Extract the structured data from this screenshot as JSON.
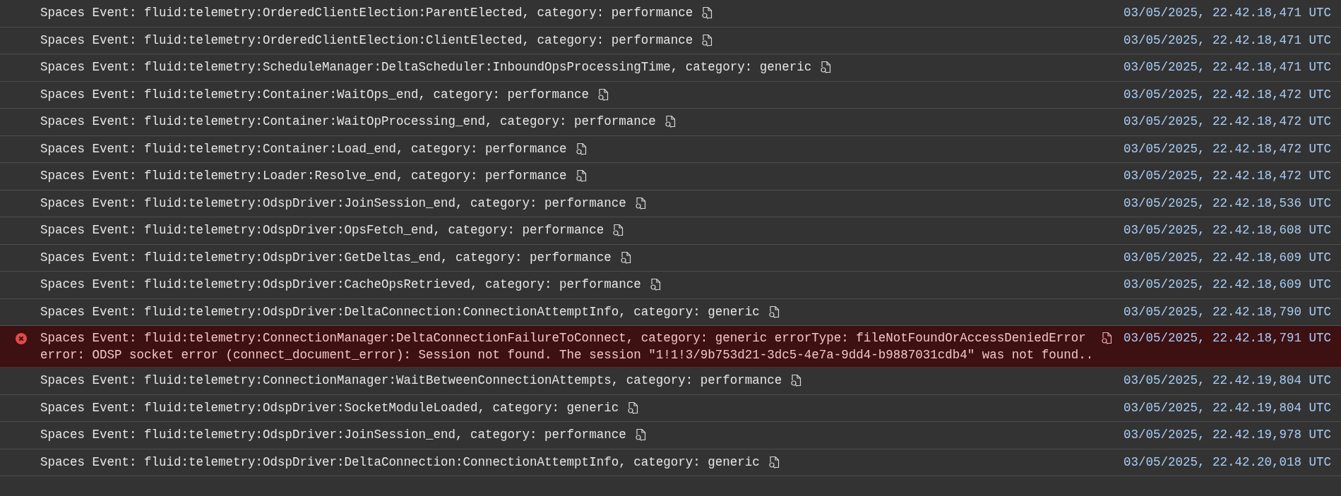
{
  "log_rows": [
    {
      "kind": "info",
      "message": "Spaces Event: fluid:telemetry:OrderedClientElection:ParentElected, category: performance",
      "timestamp": "03/05/2025, 22.42.18,471 UTC"
    },
    {
      "kind": "info",
      "message": "Spaces Event: fluid:telemetry:OrderedClientElection:ClientElected, category: performance",
      "timestamp": "03/05/2025, 22.42.18,471 UTC"
    },
    {
      "kind": "info",
      "message": "Spaces Event: fluid:telemetry:ScheduleManager:DeltaScheduler:InboundOpsProcessingTime, category: generic",
      "timestamp": "03/05/2025, 22.42.18,471 UTC"
    },
    {
      "kind": "info",
      "message": "Spaces Event: fluid:telemetry:Container:WaitOps_end, category: performance",
      "timestamp": "03/05/2025, 22.42.18,472 UTC"
    },
    {
      "kind": "info",
      "message": "Spaces Event: fluid:telemetry:Container:WaitOpProcessing_end, category: performance",
      "timestamp": "03/05/2025, 22.42.18,472 UTC"
    },
    {
      "kind": "info",
      "message": "Spaces Event: fluid:telemetry:Container:Load_end, category: performance",
      "timestamp": "03/05/2025, 22.42.18,472 UTC"
    },
    {
      "kind": "info",
      "message": "Spaces Event: fluid:telemetry:Loader:Resolve_end, category: performance",
      "timestamp": "03/05/2025, 22.42.18,472 UTC"
    },
    {
      "kind": "info",
      "message": "Spaces Event: fluid:telemetry:OdspDriver:JoinSession_end, category: performance",
      "timestamp": "03/05/2025, 22.42.18,536 UTC"
    },
    {
      "kind": "info",
      "message": "Spaces Event: fluid:telemetry:OdspDriver:OpsFetch_end, category: performance",
      "timestamp": "03/05/2025, 22.42.18,608 UTC"
    },
    {
      "kind": "info",
      "message": "Spaces Event: fluid:telemetry:OdspDriver:GetDeltas_end, category: performance",
      "timestamp": "03/05/2025, 22.42.18,609 UTC"
    },
    {
      "kind": "info",
      "message": "Spaces Event: fluid:telemetry:OdspDriver:CacheOpsRetrieved, category: performance",
      "timestamp": "03/05/2025, 22.42.18,609 UTC"
    },
    {
      "kind": "info",
      "message": "Spaces Event: fluid:telemetry:OdspDriver:DeltaConnection:ConnectionAttemptInfo, category: generic",
      "timestamp": "03/05/2025, 22.42.18,790 UTC"
    },
    {
      "kind": "error",
      "message": "Spaces Event: fluid:telemetry:ConnectionManager:DeltaConnectionFailureToConnect, category: generic errorType: fileNotFoundOrAccessDeniedError error: ODSP socket error (connect_document_error): Session not found. The session \"1!1!3/9b753d21-3dc5-4e7a-9dd4-b9887031cdb4\" was not found..",
      "timestamp": "03/05/2025, 22.42.18,791 UTC"
    },
    {
      "kind": "info",
      "message": "Spaces Event: fluid:telemetry:ConnectionManager:WaitBetweenConnectionAttempts, category: performance",
      "timestamp": "03/05/2025, 22.42.19,804 UTC"
    },
    {
      "kind": "info",
      "message": "Spaces Event: fluid:telemetry:OdspDriver:SocketModuleLoaded, category: generic",
      "timestamp": "03/05/2025, 22.42.19,804 UTC"
    },
    {
      "kind": "info",
      "message": "Spaces Event: fluid:telemetry:OdspDriver:JoinSession_end, category: performance",
      "timestamp": "03/05/2025, 22.42.19,978 UTC"
    },
    {
      "kind": "info",
      "message": "Spaces Event: fluid:telemetry:OdspDriver:DeltaConnection:ConnectionAttemptInfo, category: generic",
      "timestamp": "03/05/2025, 22.42.20,018 UTC"
    }
  ]
}
